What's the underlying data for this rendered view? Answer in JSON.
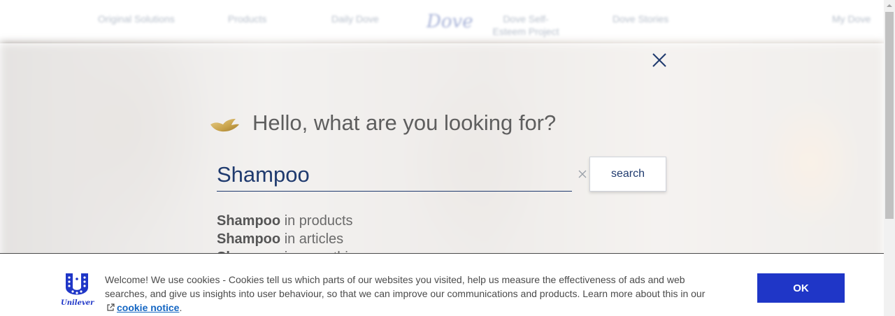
{
  "nav": {
    "items": [
      "Original Solutions",
      "Products",
      "Daily Dove",
      "Dove Self-Esteem Project",
      "Dove Stories"
    ],
    "logo_text": "Dove",
    "account_label": "My Dove"
  },
  "search_panel": {
    "heading": "Hello, what are you looking for?",
    "query": "Shampoo",
    "button_label": "search",
    "suggestions": [
      {
        "term": "Shampoo",
        "scope": "in products"
      },
      {
        "term": "Shampoo",
        "scope": "in articles"
      },
      {
        "term": "Shampoo",
        "scope": "in everything"
      }
    ]
  },
  "cookie": {
    "logo_text": "Unilever",
    "text": "Welcome! We use cookies - Cookies tell us which parts of our websites you visited, help us measure the effectiveness of ads and web searches, and give us insights into user behaviour, so that we can improve our communications and products. Learn more about this in our",
    "link_label": "cookie notice",
    "suffix": ".",
    "ok_label": "OK"
  },
  "colors": {
    "navy": "#1f3a6e",
    "brand_gold": "#c8a24a",
    "ok_blue": "#1f36c7",
    "link_blue": "#1466c3"
  },
  "icons": [
    "close-icon",
    "dove-icon",
    "clear-icon",
    "external-link-icon",
    "unilever-logo-icon",
    "scroll-up-arrow-icon"
  ]
}
